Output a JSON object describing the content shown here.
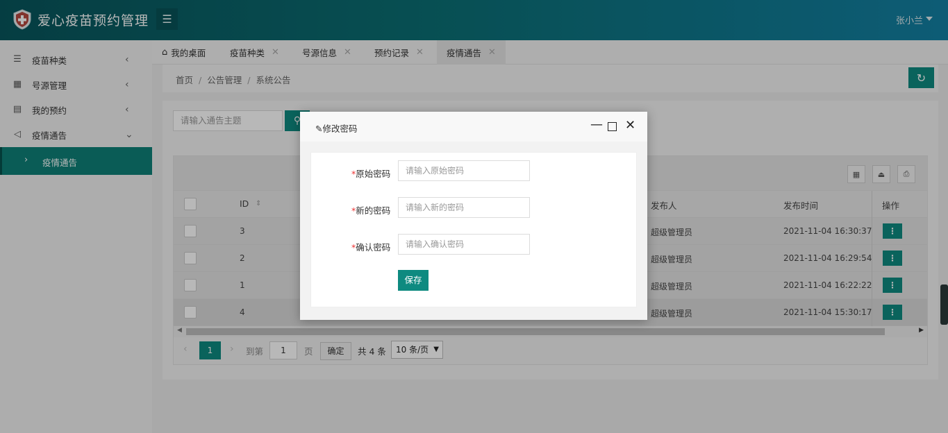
{
  "header": {
    "app_title": "爱心疫苗预约管理",
    "user_name": "张小兰"
  },
  "sidebar": {
    "items": [
      {
        "label": "疫苗种类",
        "icon": "list-icon",
        "arrow": "‹"
      },
      {
        "label": "号源管理",
        "icon": "grid-icon",
        "arrow": "‹"
      },
      {
        "label": "我的预约",
        "icon": "calendar-icon",
        "arrow": "‹"
      },
      {
        "label": "疫情通告",
        "icon": "speaker-icon",
        "arrow": "⌄"
      }
    ],
    "sub_item": {
      "label": "疫情通告"
    }
  },
  "tabs": [
    {
      "label": "我的桌面",
      "closable": false
    },
    {
      "label": "疫苗种类",
      "closable": true
    },
    {
      "label": "号源信息",
      "closable": true
    },
    {
      "label": "预约记录",
      "closable": true
    },
    {
      "label": "疫情通告",
      "closable": true,
      "active": true
    }
  ],
  "breadcrumb": [
    "首页",
    "公告管理",
    "系统公告"
  ],
  "search": {
    "placeholder": "请输入通告主题"
  },
  "table": {
    "columns": {
      "id": "ID",
      "publisher": "发布人",
      "time": "发布时间",
      "action": "操作"
    },
    "rows": [
      {
        "id": "3",
        "publisher": "超级管理员",
        "time": "2021-11-04 16:30:37"
      },
      {
        "id": "2",
        "publisher": "超级管理员",
        "time": "2021-11-04 16:29:54"
      },
      {
        "id": "1",
        "publisher": "超级管理员",
        "time": "2021-11-04 16:22:22"
      },
      {
        "id": "4",
        "publisher": "超级管理员",
        "time": "2021-11-04 15:30:17"
      }
    ],
    "op_label": "⋮"
  },
  "pager": {
    "current": "1",
    "goto_label": "到第",
    "page_input": "1",
    "page_label": "页",
    "confirm_label": "确定",
    "total": "共 4 条",
    "page_size": "10 条/页"
  },
  "modal": {
    "title": "修改密码",
    "fields": [
      {
        "label": "原始密码",
        "placeholder": "请输入原始密码"
      },
      {
        "label": "新的密码",
        "placeholder": "请输入新的密码"
      },
      {
        "label": "确认密码",
        "placeholder": "请输入确认密码"
      }
    ],
    "required_mark": "*",
    "save_label": "保存"
  },
  "colors": {
    "primary": "#0e8a80",
    "header_start": "#08555c",
    "header_end": "#1380a3"
  }
}
